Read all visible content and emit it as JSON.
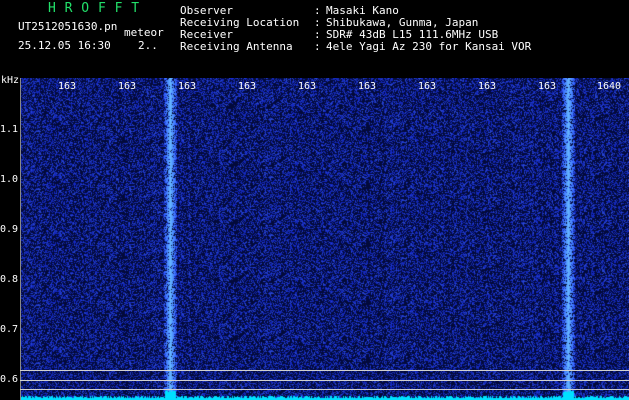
{
  "header": {
    "app_title": "H R O F F T",
    "file_name": "UT2512051630.pn",
    "meteor_label": "meteor",
    "datetime": "25.12.05 16:30",
    "count": "2..",
    "info": [
      {
        "label": "Observer",
        "value": "Masaki Kano"
      },
      {
        "label": "Receiving Location",
        "value": "Shibukawa, Gunma, Japan"
      },
      {
        "label": "Receiver",
        "value": "SDR# 43dB L15 111.6MHz USB"
      },
      {
        "label": "Receiving Antenna",
        "value": "4ele Yagi Az 230 for Kansai VOR"
      }
    ],
    "colon": ":"
  },
  "spectrogram": {
    "unit": "kHz",
    "y_ticks": [
      "1.1",
      "1.0",
      "0.9",
      "0.8",
      "0.7",
      "0.6"
    ],
    "x_ticks": [
      "163",
      "163",
      "163",
      "163",
      "163",
      "163",
      "163",
      "163",
      "163",
      "1640"
    ],
    "colors": {
      "background": "#030a3a",
      "noise": "#1a3ad0",
      "signal": "#4a7aff",
      "baseline": "#00e0ff"
    }
  }
}
